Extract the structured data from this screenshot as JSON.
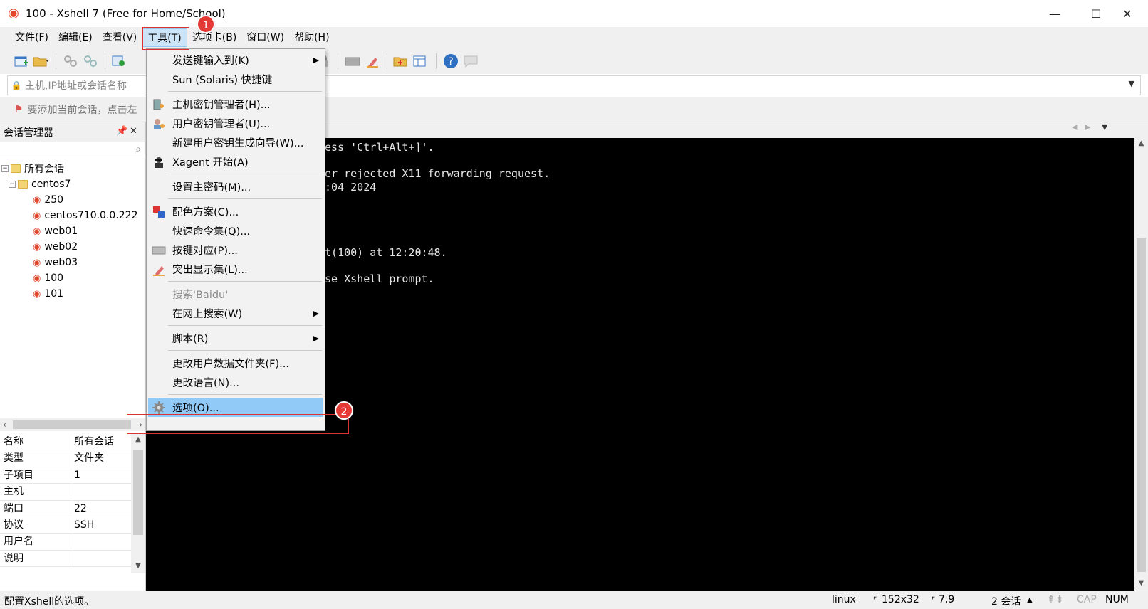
{
  "window": {
    "title": "100 - Xshell 7 (Free for Home/School)",
    "minimize": "—",
    "maximize": "☐",
    "close": "✕"
  },
  "menubar": {
    "items": [
      {
        "label": "文件(F)"
      },
      {
        "label": "编辑(E)"
      },
      {
        "label": "查看(V)"
      },
      {
        "label": "工具(T)",
        "active": true
      },
      {
        "label": "选项卡(B)"
      },
      {
        "label": "窗口(W)"
      },
      {
        "label": "帮助(H)"
      }
    ]
  },
  "addressbar": {
    "placeholder": "主机,IP地址或会话名称"
  },
  "hintbar": {
    "text": "要添加当前会话，点击左"
  },
  "session_manager": {
    "title": "会话管理器",
    "tree": {
      "root": "所有会话",
      "folder": "centos7",
      "sessions": [
        "250",
        "centos710.0.0.222",
        "web01",
        "web02",
        "web03",
        "100",
        "101"
      ]
    }
  },
  "properties": [
    {
      "key": "名称",
      "value": "所有会话"
    },
    {
      "key": "类型",
      "value": "文件夹"
    },
    {
      "key": "子项目",
      "value": "1"
    },
    {
      "key": "主机",
      "value": ""
    },
    {
      "key": "端口",
      "value": "22"
    },
    {
      "key": "协议",
      "value": "SSH"
    },
    {
      "key": "用户名",
      "value": ""
    },
    {
      "key": "说明",
      "value": ""
    }
  ],
  "terminal": {
    "lines": [
      "ress 'Ctrl+Alt+]'.",
      "ver rejected X11 forwarding request.",
      "0:04 2024",
      "st(100) at 12:20:48.",
      "use Xshell prompt."
    ]
  },
  "tools_menu": {
    "items": [
      {
        "label": "发送键输入到(K)",
        "submenu": true
      },
      {
        "label": "Sun (Solaris) 快捷键"
      },
      {
        "label": "主机密钥管理者(H)...",
        "icon": "host-key-icon"
      },
      {
        "label": "用户密钥管理者(U)...",
        "icon": "user-key-icon"
      },
      {
        "label": "新建用户密钥生成向导(W)..."
      },
      {
        "label": "Xagent 开始(A)",
        "icon": "xagent-icon"
      },
      {
        "label": "设置主密码(M)..."
      },
      {
        "label": "配色方案(C)...",
        "icon": "color-scheme-icon"
      },
      {
        "label": "快速命令集(Q)..."
      },
      {
        "label": "按键对应(P)...",
        "icon": "keyboard-icon"
      },
      {
        "label": "突出显示集(L)...",
        "icon": "highlighter-icon"
      },
      {
        "label": "搜索'Baidu'",
        "disabled": true
      },
      {
        "label": "在网上搜索(W)",
        "submenu": true
      },
      {
        "label": "脚本(R)",
        "submenu": true
      },
      {
        "label": "更改用户数据文件夹(F)..."
      },
      {
        "label": "更改语言(N)..."
      },
      {
        "label": "选项(O)...",
        "icon": "gear-icon",
        "highlight": true
      }
    ]
  },
  "annotations": {
    "badge1": "1",
    "badge2": "2"
  },
  "statusbar": {
    "message": "配置Xshell的选项。",
    "terminal_type": "linux",
    "size": "152x32",
    "cursor": "7,9",
    "sessions": "2 会话",
    "cap": "CAP",
    "num": "NUM"
  },
  "colors": {
    "menu_highlight": "#91c9f7",
    "annotation_red": "#e53935",
    "terminal_bg": "#000000"
  }
}
